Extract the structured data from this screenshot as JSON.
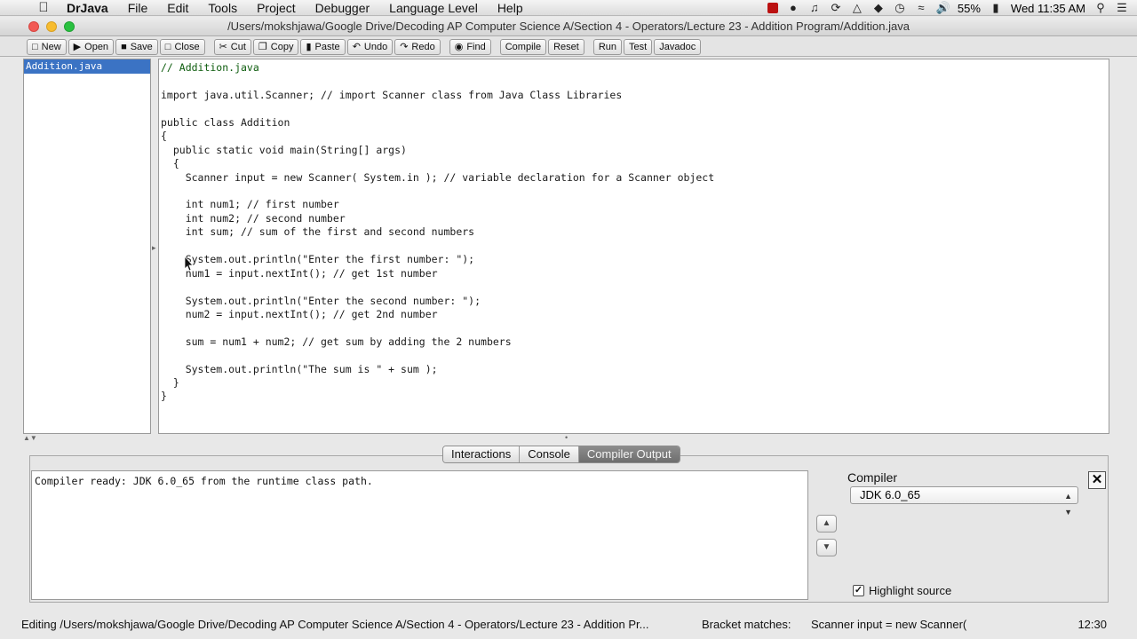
{
  "menubar": {
    "app_name": "DrJava",
    "items": [
      "File",
      "Edit",
      "Tools",
      "Project",
      "Debugger",
      "Language Level",
      "Help"
    ],
    "battery": "55%",
    "datetime": "Wed 11:35 AM"
  },
  "window": {
    "title": "/Users/mokshjawa/Google Drive/Decoding AP Computer Science A/Section 4 - Operators/Lecture 23 - Addition Program/Addition.java"
  },
  "toolbar": {
    "buttons": [
      {
        "label": "New",
        "icon": "new-file-icon"
      },
      {
        "label": "Open",
        "icon": "open-folder-icon"
      },
      {
        "label": "Save",
        "icon": "save-icon"
      },
      {
        "label": "Close",
        "icon": "close-file-icon"
      },
      {
        "label": "Cut",
        "icon": "scissors-icon"
      },
      {
        "label": "Copy",
        "icon": "copy-icon"
      },
      {
        "label": "Paste",
        "icon": "paste-icon"
      },
      {
        "label": "Undo",
        "icon": "undo-icon"
      },
      {
        "label": "Redo",
        "icon": "redo-icon"
      },
      {
        "label": "Find",
        "icon": "binoculars-icon"
      },
      {
        "label": "Compile"
      },
      {
        "label": "Reset"
      },
      {
        "label": "Run"
      },
      {
        "label": "Test"
      },
      {
        "label": "Javadoc"
      }
    ]
  },
  "files": {
    "items": [
      "Addition.java"
    ]
  },
  "editor": {
    "lines": [
      "// Addition.java",
      "",
      "import java.util.Scanner; // import Scanner class from Java Class Libraries",
      "",
      "public class Addition",
      "{",
      "  public static void main(String[] args)",
      "  {",
      "    Scanner input = new Scanner( System.in ); // variable declaration for a Scanner object",
      "",
      "    int num1; // first number",
      "    int num2; // second number",
      "    int sum; // sum of the first and second numbers",
      "",
      "    System.out.println(\"Enter the first number: \");",
      "    num1 = input.nextInt(); // get 1st number",
      "",
      "    System.out.println(\"Enter the second number: \");",
      "    num2 = input.nextInt(); // get 2nd number",
      "",
      "    sum = num1 + num2; // get sum by adding the 2 numbers",
      "",
      "    System.out.println(\"The sum is \" + sum );",
      "  }",
      "}"
    ]
  },
  "bottom": {
    "tabs": [
      "Interactions",
      "Console",
      "Compiler Output"
    ],
    "active_tab": "Compiler Output",
    "output": "Compiler ready: JDK 6.0_65 from the runtime class path.",
    "compiler_label": "Compiler",
    "compiler_value": "JDK 6.0_65",
    "highlight_source_label": "Highlight source",
    "highlight_source_checked": true
  },
  "status": {
    "editing": "Editing /Users/mokshjawa/Google Drive/Decoding AP Computer Science A/Section 4 - Operators/Lecture 23 - Addition Pr...",
    "bracket_label": "Bracket matches:",
    "bracket_text": "Scanner input = new Scanner(",
    "position": "12:30"
  }
}
